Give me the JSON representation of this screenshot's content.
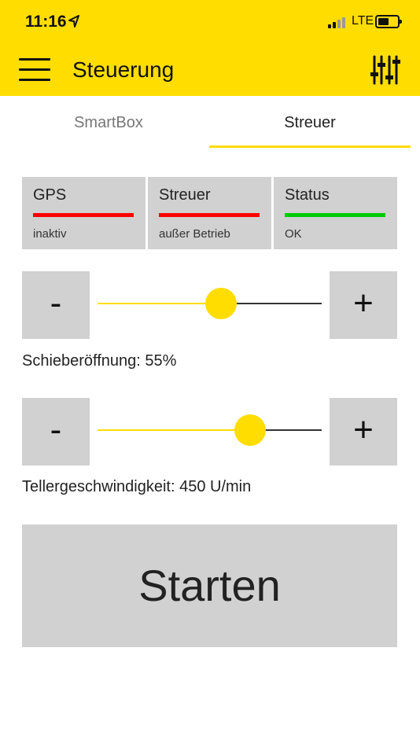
{
  "status_bar": {
    "time": "11:16",
    "network": "LTE",
    "battery_level": 0.55
  },
  "header": {
    "title": "Steuerung"
  },
  "tabs": [
    {
      "label": "SmartBox",
      "active": false
    },
    {
      "label": "Streuer",
      "active": true
    }
  ],
  "status_cards": [
    {
      "title": "GPS",
      "value": "inaktiv",
      "color": "#FF0000"
    },
    {
      "title": "Streuer",
      "value": "außer Betrieb",
      "color": "#FF0000"
    },
    {
      "title": "Status",
      "value": "OK",
      "color": "#00CC00"
    }
  ],
  "controls": {
    "minus_label": "-",
    "plus_label": "+",
    "opening": {
      "label": "Schieberöffnung: 55%",
      "value_fraction": 0.55
    },
    "speed": {
      "label": "Tellergeschwindigkeit: 450 U/min",
      "value_fraction": 0.68
    }
  },
  "start_button": {
    "label": "Starten"
  },
  "colors": {
    "accent": "#FFDD00",
    "panel": "#D1D1D1",
    "error": "#FF0000",
    "ok": "#00CC00"
  }
}
